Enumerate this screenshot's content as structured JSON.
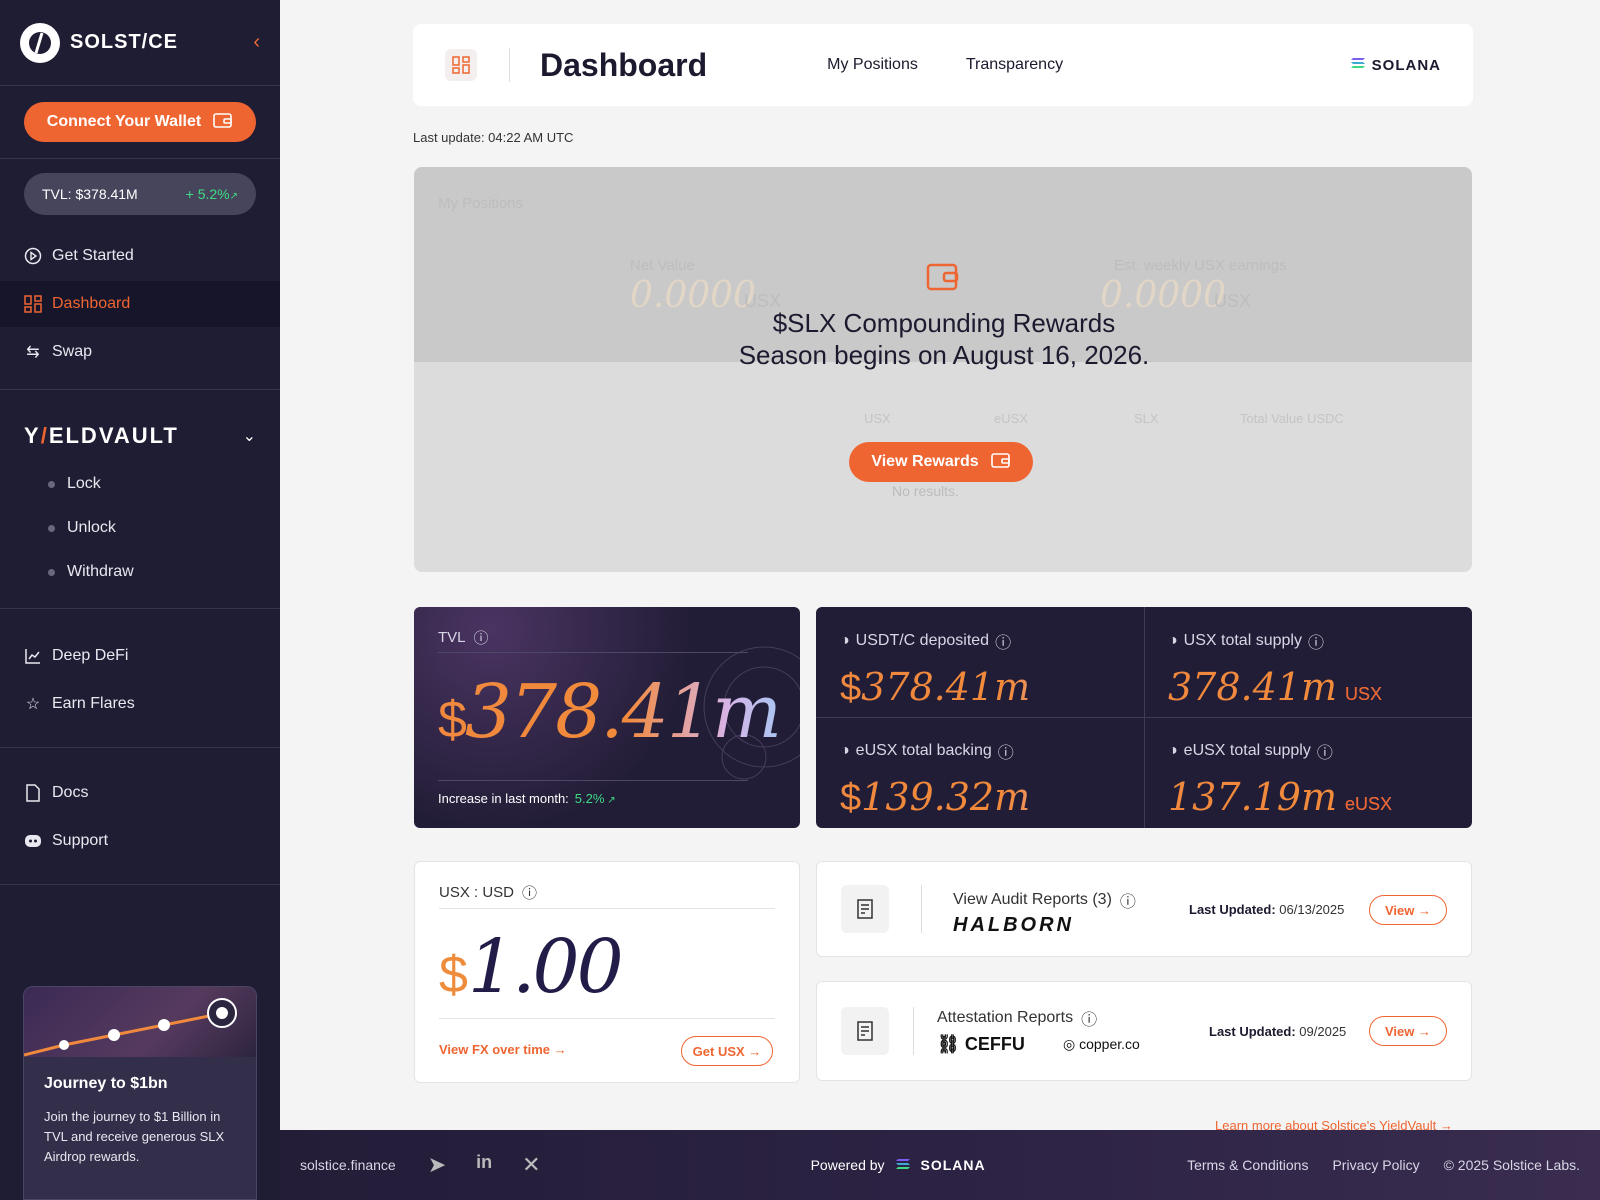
{
  "sidebar": {
    "logo_text": "SOLST/CE",
    "connect_wallet": "Connect Your Wallet",
    "tvl_label": "TVL: $378.41M",
    "tvl_change": "+ 5.2%",
    "nav": [
      {
        "label": "Get Started"
      },
      {
        "label": "Dashboard"
      },
      {
        "label": "Swap"
      }
    ],
    "yieldvault": {
      "title_prefix": "Y",
      "title_slash": "/",
      "title_suffix": "ELDVAULT",
      "items": [
        {
          "label": "Lock"
        },
        {
          "label": "Unlock"
        },
        {
          "label": "Withdraw"
        }
      ]
    },
    "nav2": [
      {
        "label": "Deep DeFi"
      },
      {
        "label": "Earn Flares"
      }
    ],
    "nav3": [
      {
        "label": "Docs"
      },
      {
        "label": "Support"
      }
    ],
    "journey": {
      "title": "Journey to $1bn",
      "text": "Join the journey to $1 Billion in TVL and receive generous SLX Airdrop rewards."
    }
  },
  "header": {
    "title": "Dashboard",
    "links": [
      "My Positions",
      "Transparency"
    ],
    "brand": "SOLANA"
  },
  "last_update": "Last update: 04:22 AM UTC",
  "positions": {
    "title": "My Positions",
    "net_value_label": "Net Value",
    "net_value": "0.0000",
    "net_value_unit": "USX",
    "weekly_label": "Est. weekly USX earnings",
    "weekly_value": "0.0000",
    "weekly_unit": "USX",
    "columns": [
      "USX",
      "eUSX",
      "SLX",
      "Total Value USDC"
    ],
    "empty": "No results."
  },
  "promo": {
    "text": "$SLX Compounding Rewards Season begins on August 16, 2026.",
    "button": "View Rewards"
  },
  "tvl_card": {
    "label": "TVL",
    "currency": "$",
    "value": "378.41m",
    "increase_label": "Increase in last month:",
    "increase_value": "5.2%"
  },
  "stats": [
    {
      "label": "USDT/C deposited",
      "prefix": "$",
      "value": "378.41m",
      "unit": ""
    },
    {
      "label": "USX total supply",
      "prefix": "",
      "value": "378.41m",
      "unit": "USX"
    },
    {
      "label": "eUSX total backing",
      "prefix": "$",
      "value": "139.32m",
      "unit": ""
    },
    {
      "label": "eUSX total supply",
      "prefix": "",
      "value": "137.19m",
      "unit": "eUSX"
    }
  ],
  "usd_card": {
    "label": "USX : USD",
    "currency": "$",
    "value": "1.00",
    "fx_link": "View FX over time",
    "get_usx": "Get USX"
  },
  "audit": {
    "title": "View Audit Reports (3)",
    "logo": "HALBORN",
    "updated_label": "Last Updated:",
    "updated_value": "06/13/2025",
    "button": "View"
  },
  "attestation": {
    "title": "Attestation Reports",
    "logo1": "CEFFU",
    "logo2": "copper.co",
    "updated_label": "Last Updated:",
    "updated_value": "09/2025",
    "button": "View"
  },
  "learn_more": "Learn more about Solstice's YieldVault",
  "footer": {
    "site": "solstice.finance",
    "powered": "Powered by",
    "brand": "SOLANA",
    "links": [
      "Terms & Conditions",
      "Privacy Policy",
      "© 2025 Solstice Labs."
    ]
  },
  "colors": {
    "accent": "#ef6532",
    "sidebar_bg": "#1f1d33",
    "positive": "#3ddc84"
  }
}
